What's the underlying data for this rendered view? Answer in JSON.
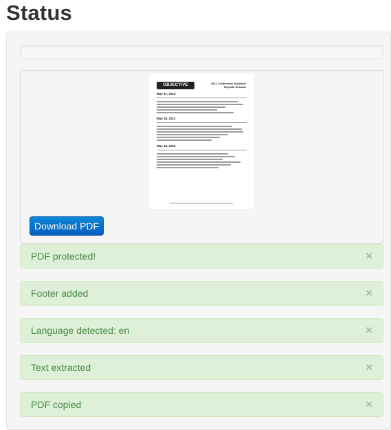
{
  "page": {
    "title": "Status"
  },
  "preview": {
    "download_label": "Download PDF",
    "thumbnail": {
      "logo": "OBJECTIVE",
      "header_line1": "2012 Conference Schedule",
      "header_line2": "Keynote Session",
      "sections": [
        "May 17, 2012",
        "May 18, 2012",
        "May 19, 2012"
      ]
    }
  },
  "alerts": [
    {
      "text": "PDF protected!",
      "close": "×"
    },
    {
      "text": "Footer added",
      "close": "×"
    },
    {
      "text": "Language detected: en",
      "close": "×"
    },
    {
      "text": "Text extracted",
      "close": "×"
    },
    {
      "text": "PDF copied",
      "close": "×"
    }
  ],
  "colors": {
    "alert_bg": "#dff0d8",
    "alert_text": "#468847",
    "button": "#0460c0"
  }
}
